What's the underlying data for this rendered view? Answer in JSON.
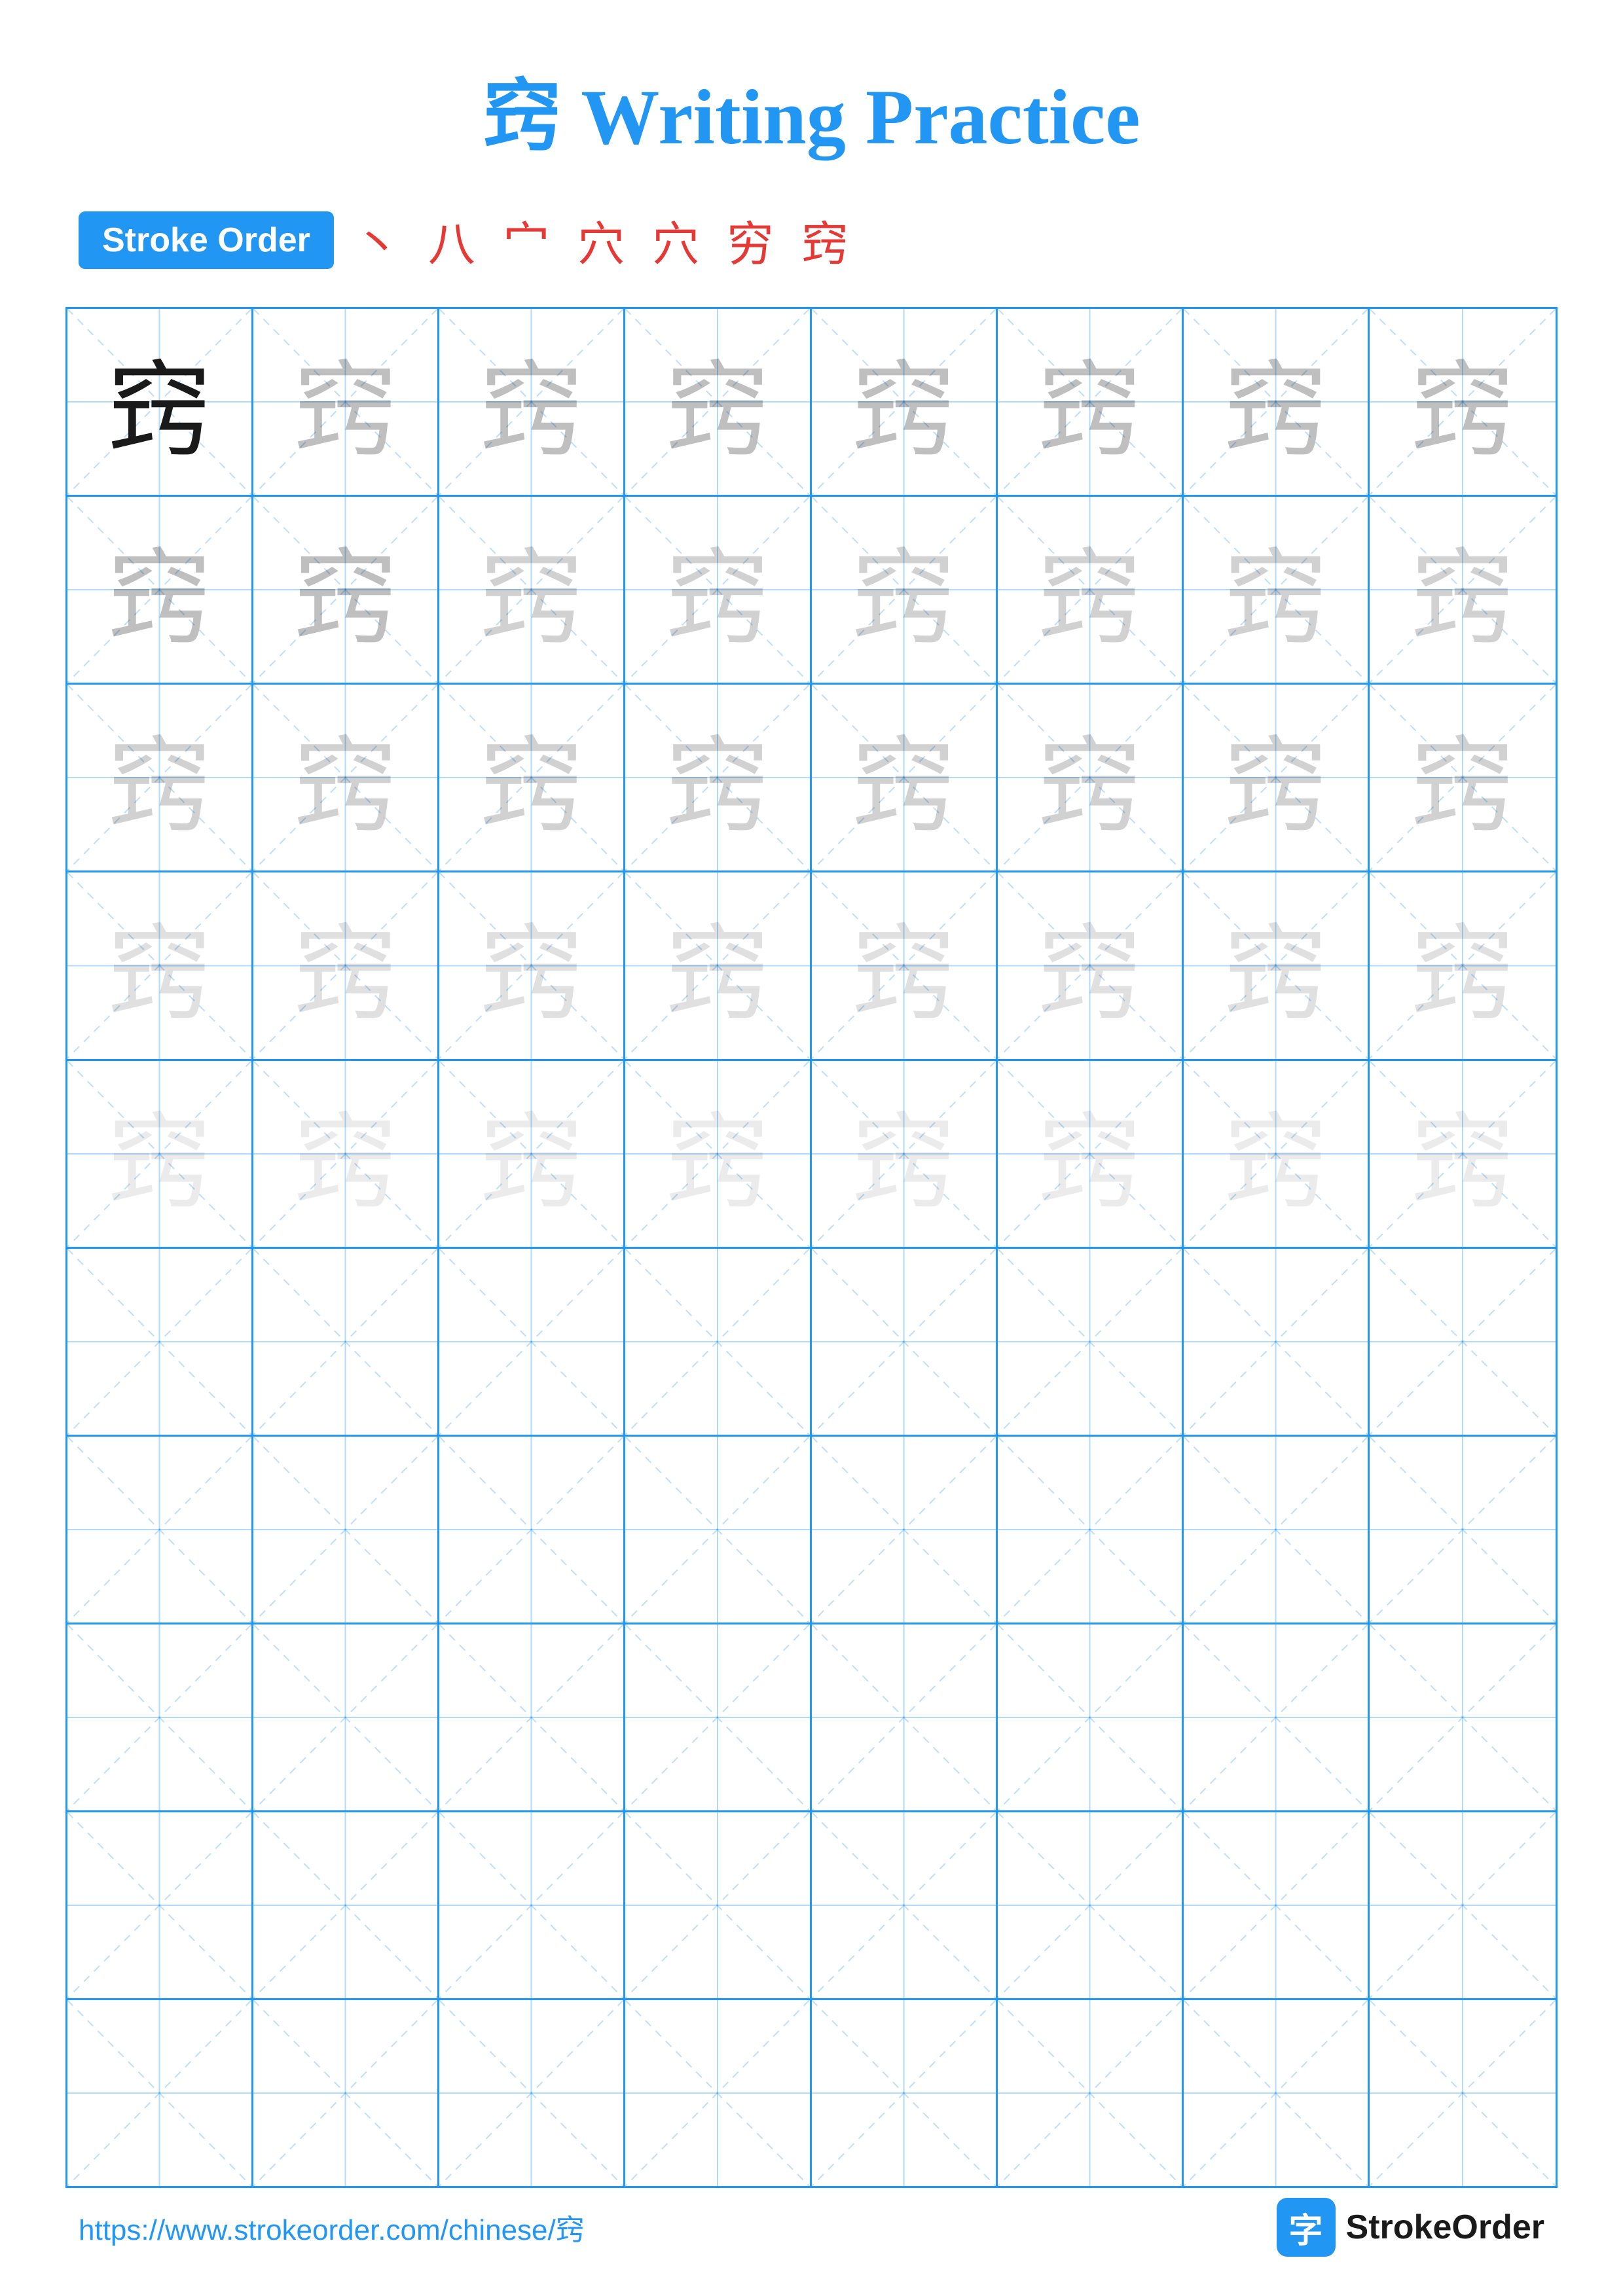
{
  "page": {
    "title": "窍 Writing Practice",
    "char": "窍",
    "stroke_order_label": "Stroke Order",
    "stroke_sequence": [
      "丶",
      "八",
      "宀",
      "穴",
      "穴",
      "穷",
      "窍"
    ],
    "footer_url": "https://www.strokeorder.com/chinese/窍",
    "footer_logo_text": "StrokeOrder",
    "footer_logo_char": "字",
    "rows": [
      {
        "type": "practice",
        "shades": [
          "dark",
          "light1",
          "light1",
          "light1",
          "light1",
          "light1",
          "light1",
          "light1"
        ]
      },
      {
        "type": "practice",
        "shades": [
          "light1",
          "light1",
          "light2",
          "light2",
          "light2",
          "light2",
          "light2",
          "light2"
        ]
      },
      {
        "type": "practice",
        "shades": [
          "light2",
          "light2",
          "light2",
          "light2",
          "light2",
          "light2",
          "light2",
          "light2"
        ]
      },
      {
        "type": "practice",
        "shades": [
          "light3",
          "light3",
          "light3",
          "light3",
          "light3",
          "light3",
          "light3",
          "light3"
        ]
      },
      {
        "type": "practice",
        "shades": [
          "light4",
          "light4",
          "light4",
          "light4",
          "light4",
          "light4",
          "light4",
          "light4"
        ]
      },
      {
        "type": "empty"
      },
      {
        "type": "empty"
      },
      {
        "type": "empty"
      },
      {
        "type": "empty"
      },
      {
        "type": "empty"
      }
    ]
  }
}
